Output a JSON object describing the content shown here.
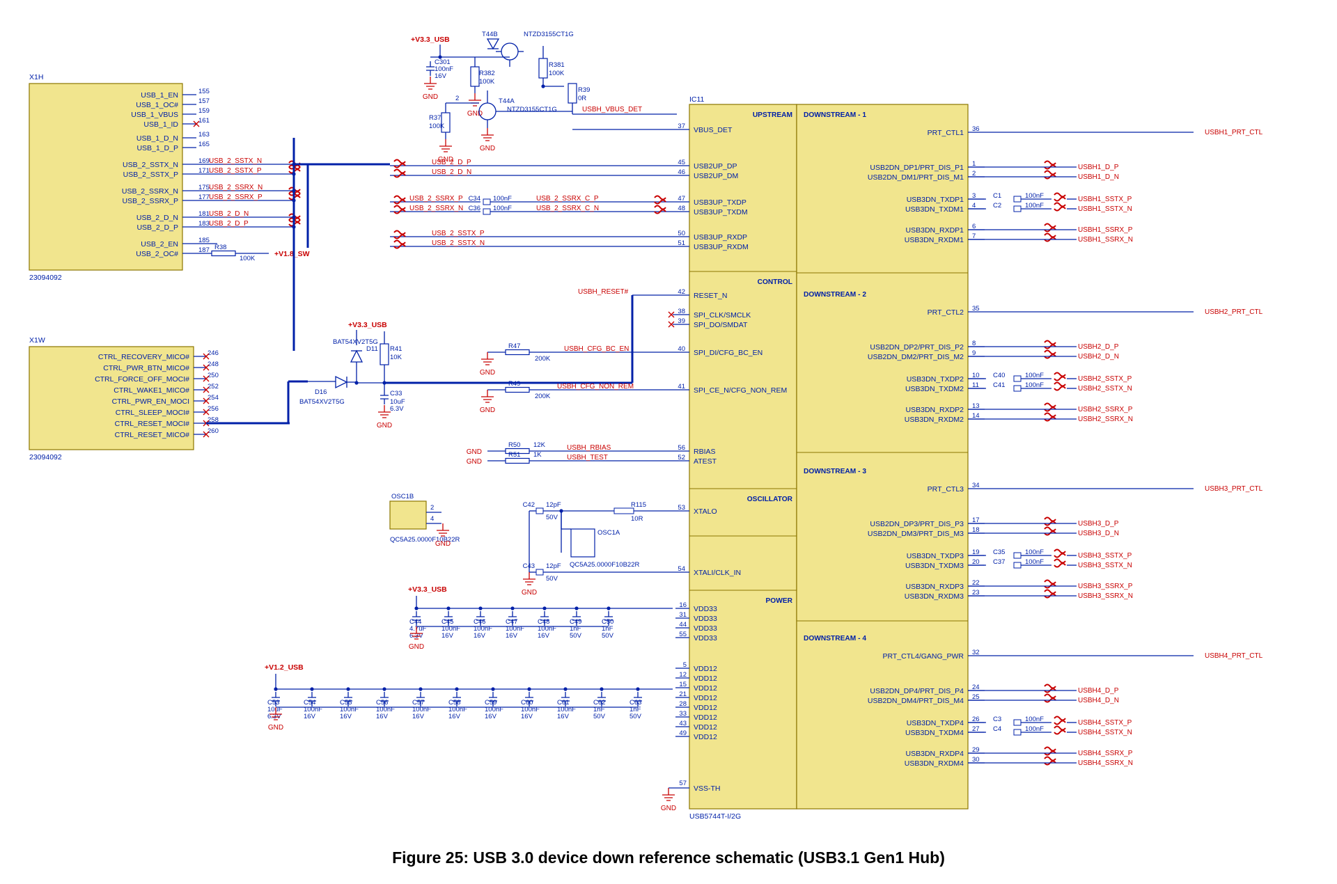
{
  "figure": {
    "caption": "Figure 25: USB 3.0 device down reference schematic (USB3.1 Gen1 Hub)"
  },
  "ic": {
    "ref": "IC11",
    "part": "USB5744T-I/2G"
  },
  "x1h": {
    "ref": "X1H",
    "part": "23094092",
    "pins": [
      "USB_1_EN",
      "USB_1_OC#",
      "USB_1_VBUS",
      "USB_1_ID",
      "USB_1_D_N",
      "USB_1_D_P",
      "USB_2_SSTX_N",
      "USB_2_SSTX_P",
      "USB_2_SSRX_N",
      "USB_2_SSRX_P",
      "USB_2_D_N",
      "USB_2_D_P",
      "USB_2_EN",
      "USB_2_OC#"
    ],
    "nums": [
      "155",
      "157",
      "159",
      "161",
      "163",
      "165",
      "169",
      "171",
      "175",
      "177",
      "181",
      "183",
      "185",
      "187"
    ]
  },
  "x1w": {
    "ref": "X1W",
    "part": "23094092",
    "pins": [
      "CTRL_RECOVERY_MICO#",
      "CTRL_PWR_BTN_MICO#",
      "CTRL_FORCE_OFF_MOCI#",
      "CTRL_WAKE1_MICO#",
      "CTRL_PWR_EN_MOCI",
      "CTRL_SLEEP_MOCI#",
      "CTRL_RESET_MOCI#",
      "CTRL_RESET_MICO#"
    ],
    "nums": [
      "246",
      "248",
      "250",
      "252",
      "254",
      "256",
      "258",
      "260"
    ]
  },
  "upstream": {
    "title": "UPSTREAM",
    "pins": [
      "VBUS_DET",
      "USB2UP_DP",
      "USB2UP_DM",
      "USB3UP_TXDP",
      "USB3UP_TXDM",
      "USB3UP_RXDP",
      "USB3UP_RXDM"
    ],
    "nums": [
      "37",
      "45",
      "46",
      "47",
      "48",
      "50",
      "51"
    ],
    "nets": [
      "USBH_VBUS_DET",
      "USB_2_D_P",
      "USB_2_D_N",
      "USB_2_SSRX_C_P",
      "USB_2_SSRX_C_N",
      "USB_2_SSTX_P",
      "USB_2_SSTX_N"
    ],
    "extra": [
      "USB_2_SSRX_P",
      "USB_2_SSRX_N"
    ],
    "caps": [
      "C34",
      "C36"
    ],
    "capvals": [
      "100nF",
      "100nF"
    ]
  },
  "control": {
    "title": "CONTROL",
    "pins": [
      "RESET_N",
      "SPI_CLK/SMCLK",
      "SPI_DO/SMDAT",
      "SPI_DI/CFG_BC_EN",
      "SPI_CE_N/CFG_NON_REM",
      "RBIAS",
      "ATEST"
    ],
    "nums": [
      "42",
      "38",
      "39",
      "40",
      "41",
      "56",
      "52"
    ],
    "nets": [
      "USBH_RESET#",
      "",
      "",
      "USBH_CFG_BC_EN",
      "USBH_CFG_NON_REM",
      "USBH_RBIAS",
      "USBH_TEST"
    ],
    "r47": {
      "ref": "R47",
      "val": "200K"
    },
    "r49": {
      "ref": "R49",
      "val": "200K"
    },
    "r50": {
      "ref": "R50",
      "val": "12K"
    },
    "r51": {
      "ref": "R51",
      "val": "1K"
    }
  },
  "osc": {
    "title": "OSCILLATOR",
    "pins": [
      "XTALO",
      "XTALI/CLK_IN"
    ],
    "nums": [
      "53",
      "54"
    ],
    "r": {
      "ref": "R115",
      "val": "10R"
    },
    "c1": {
      "ref": "C42",
      "val1": "12pF",
      "val2": "50V"
    },
    "c2": {
      "ref": "C43",
      "val1": "12pF",
      "val2": "50V"
    },
    "y": {
      "ref": "OSC1A",
      "part": "QC5A25.0000F10B22R",
      "ref2": "OSC1B"
    }
  },
  "power": {
    "title": "POWER",
    "v33pins": [
      "16",
      "31",
      "44",
      "55"
    ],
    "v12pins": [
      "5",
      "12",
      "15",
      "21",
      "28",
      "33",
      "43",
      "49"
    ],
    "gndpin": "57",
    "v33": [
      {
        "ref": "C44",
        "v1": "4.7uF",
        "v2": "6.3V"
      },
      {
        "ref": "C45",
        "v1": "100nF",
        "v2": "16V"
      },
      {
        "ref": "C46",
        "v1": "100nF",
        "v2": "16V"
      },
      {
        "ref": "C47",
        "v1": "100nF",
        "v2": "16V"
      },
      {
        "ref": "C48",
        "v1": "100nF",
        "v2": "16V"
      },
      {
        "ref": "C49",
        "v1": "1nF",
        "v2": "50V"
      },
      {
        "ref": "C50",
        "v1": "1nF",
        "v2": "50V"
      }
    ],
    "v12": [
      {
        "ref": "C53",
        "v1": "10uF",
        "v2": "6.3V"
      },
      {
        "ref": "C54",
        "v1": "100nF",
        "v2": "16V"
      },
      {
        "ref": "C55",
        "v1": "100nF",
        "v2": "16V"
      },
      {
        "ref": "C56",
        "v1": "100nF",
        "v2": "16V"
      },
      {
        "ref": "C57",
        "v1": "100nF",
        "v2": "16V"
      },
      {
        "ref": "C58",
        "v1": "100nF",
        "v2": "16V"
      },
      {
        "ref": "C59",
        "v1": "100nF",
        "v2": "16V"
      },
      {
        "ref": "C60",
        "v1": "100nF",
        "v2": "16V"
      },
      {
        "ref": "C61",
        "v1": "100nF",
        "v2": "16V"
      },
      {
        "ref": "C62",
        "v1": "1nF",
        "v2": "50V"
      },
      {
        "ref": "C63",
        "v1": "1nF",
        "v2": "50V"
      }
    ]
  },
  "ds": [
    {
      "title": "DOWNSTREAM - 1",
      "ctl": {
        "pin": "PRT_CTL1",
        "num": "36",
        "net": "USBH1_PRT_CTL"
      },
      "u2": [
        "USB2DN_DP1/PRT_DIS_P1",
        "USB2DN_DM1/PRT_DIS_M1"
      ],
      "u2n": [
        "1",
        "2"
      ],
      "u2net": [
        "USBH1_D_P",
        "USBH1_D_N"
      ],
      "tx": [
        "USB3DN_TXDP1",
        "USB3DN_TXDM1"
      ],
      "txn": [
        "3",
        "4"
      ],
      "txnet": [
        "USBH1_SSTX_P",
        "USBH1_SSTX_N"
      ],
      "txcap": [
        "C1",
        "C2"
      ],
      "txcapv": "100nF",
      "rx": [
        "USB3DN_RXDP1",
        "USB3DN_RXDM1"
      ],
      "rxn": [
        "6",
        "7"
      ],
      "rxnet": [
        "USBH1_SSRX_P",
        "USBH1_SSRX_N"
      ]
    },
    {
      "title": "DOWNSTREAM - 2",
      "ctl": {
        "pin": "PRT_CTL2",
        "num": "35",
        "net": "USBH2_PRT_CTL"
      },
      "u2": [
        "USB2DN_DP2/PRT_DIS_P2",
        "USB2DN_DM2/PRT_DIS_M2"
      ],
      "u2n": [
        "8",
        "9"
      ],
      "u2net": [
        "USBH2_D_P",
        "USBH2_D_N"
      ],
      "tx": [
        "USB3DN_TXDP2",
        "USB3DN_TXDM2"
      ],
      "txn": [
        "10",
        "11"
      ],
      "txnet": [
        "USBH2_SSTX_P",
        "USBH2_SSTX_N"
      ],
      "txcap": [
        "C40",
        "C41"
      ],
      "txcapv": "100nF",
      "rx": [
        "USB3DN_RXDP2",
        "USB3DN_RXDM2"
      ],
      "rxn": [
        "13",
        "14"
      ],
      "rxnet": [
        "USBH2_SSRX_P",
        "USBH2_SSRX_N"
      ]
    },
    {
      "title": "DOWNSTREAM - 3",
      "ctl": {
        "pin": "PRT_CTL3",
        "num": "34",
        "net": "USBH3_PRT_CTL"
      },
      "u2": [
        "USB2DN_DP3/PRT_DIS_P3",
        "USB2DN_DM3/PRT_DIS_M3"
      ],
      "u2n": [
        "17",
        "18"
      ],
      "u2net": [
        "USBH3_D_P",
        "USBH3_D_N"
      ],
      "tx": [
        "USB3DN_TXDP3",
        "USB3DN_TXDM3"
      ],
      "txn": [
        "19",
        "20"
      ],
      "txnet": [
        "USBH3_SSTX_P",
        "USBH3_SSTX_N"
      ],
      "txcap": [
        "C35",
        "C37"
      ],
      "txcapv": "100nF",
      "rx": [
        "USB3DN_RXDP3",
        "USB3DN_RXDM3"
      ],
      "rxn": [
        "22",
        "23"
      ],
      "rxnet": [
        "USBH3_SSRX_P",
        "USBH3_SSRX_N"
      ]
    },
    {
      "title": "DOWNSTREAM - 4",
      "ctl": {
        "pin": "PRT_CTL4/GANG_PWR",
        "num": "32",
        "net": "USBH4_PRT_CTL"
      },
      "u2": [
        "USB2DN_DP4/PRT_DIS_P4",
        "USB2DN_DM4/PRT_DIS_M4"
      ],
      "u2n": [
        "24",
        "25"
      ],
      "u2net": [
        "USBH4_D_P",
        "USBH4_D_N"
      ],
      "tx": [
        "USB3DN_TXDP4",
        "USB3DN_TXDM4"
      ],
      "txn": [
        "26",
        "27"
      ],
      "txnet": [
        "USBH4_SSTX_P",
        "USBH4_SSTX_N"
      ],
      "txcap": [
        "C3",
        "C4"
      ],
      "txcapv": "100nF",
      "rx": [
        "USB3DN_RXDP4",
        "USB3DN_RXDM4"
      ],
      "rxn": [
        "29",
        "30"
      ],
      "rxnet": [
        "USBH4_SSRX_P",
        "USBH4_SSRX_N"
      ]
    }
  ],
  "top": {
    "rail": "+V3.3_USB",
    "c": {
      "ref": "C301",
      "v1": "100nF",
      "v2": "16V"
    },
    "r382": {
      "ref": "R382",
      "val": "100K"
    },
    "r381": {
      "ref": "R381",
      "val": "100K"
    },
    "r37": {
      "ref": "R37",
      "val": "100K"
    },
    "r39": {
      "ref": "R39",
      "val": "0R"
    },
    "t1": {
      "ref": "T44B",
      "part": "NTZD3155CT1G"
    },
    "t2": {
      "ref": "T44A",
      "part": "NTZD3155CT1G"
    }
  },
  "reset": {
    "d1": {
      "ref": "D11",
      "part": "BAT54XV2T5G"
    },
    "d2": {
      "ref": "D16",
      "part": "BAT54XV2T5G"
    },
    "r": {
      "ref": "R41",
      "val": "10K"
    },
    "c": {
      "ref": "C33",
      "v1": "10uF",
      "v2": "6.3V"
    },
    "rail": "+V3.3_USB"
  },
  "misc": {
    "r38": {
      "ref": "R38",
      "val": "100K"
    },
    "sw": "+V1.8_SW",
    "v12": "+V1.2_USB",
    "v33": "+V3.3_USB",
    "gnd": "GND"
  },
  "nets_x1h": [
    "USB_2_SSTX_N",
    "USB_2_SSTX_P",
    "USB_2_SSRX_N",
    "USB_2_SSRX_P",
    "USB_2_D_N",
    "USB_2_D_P"
  ]
}
